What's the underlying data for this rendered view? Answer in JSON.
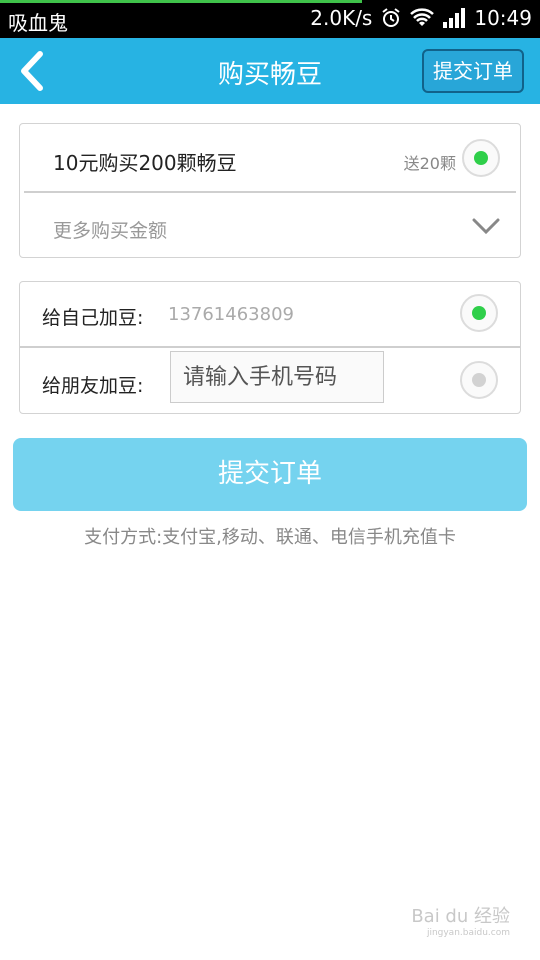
{
  "status_bar": {
    "app_name": "吸血鬼",
    "network_speed": "2.0K/s",
    "time": "10:49",
    "loading_progress": 0.67
  },
  "header": {
    "title": "购买畅豆",
    "submit_label": "提交订单",
    "back_icon": "chevron-left-icon"
  },
  "purchase": {
    "package_label": "10元购买200颗畅豆",
    "bonus_label": "送20颗",
    "package_selected": true,
    "more_amounts_label": "更多购买金额",
    "expand_icon": "chevron-down-icon"
  },
  "recipient": {
    "self_label": "给自己加豆:",
    "self_phone": "13761463809",
    "self_selected": true,
    "friend_label": "给朋友加豆:",
    "friend_placeholder": "请输入手机号码",
    "friend_selected": false
  },
  "submit_button_label": "提交订单",
  "payment_info": "支付方式:支付宝,移动、联通、电信手机充值卡",
  "watermark": {
    "brand": "Bai du 经验",
    "url": "jingyan.baidu.com"
  },
  "colors": {
    "accent": "#27b3e3",
    "submit_button": "#75d3ef",
    "radio_on": "#2fcf4a"
  }
}
